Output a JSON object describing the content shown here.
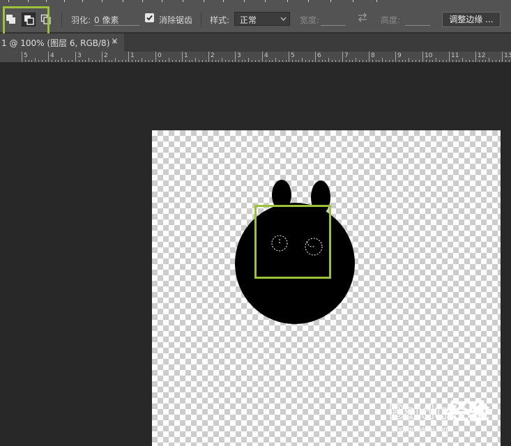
{
  "options_bar": {
    "selection_modes": [
      "new-selection",
      "add-to-selection",
      "subtract-from-selection"
    ],
    "feather_label": "羽化:",
    "feather_value": "0 像素",
    "antialias_label": "消除锯齿",
    "antialias_checked": true,
    "style_label": "样式:",
    "style_value": "正常",
    "width_label": "宽度:",
    "height_label": "高度:",
    "refine_edge_label": "调整边缘 ..."
  },
  "document_tab": {
    "title": "1 @ 100% (图层 6, RGB/8) *",
    "close_glyph": "×"
  },
  "ruler": {
    "labels": [
      "5",
      "4",
      "3",
      "2",
      "1",
      "0",
      "1",
      "2",
      "3",
      "4",
      "5",
      "6",
      "7",
      "8",
      "9",
      "10",
      "11",
      "12",
      "13"
    ]
  },
  "watermark": {
    "text": "Baidu经验",
    "sub": "jingyan.baidu.com"
  },
  "colors": {
    "highlight": "#9bc23a",
    "panel": "#535353",
    "workspace": "#282828"
  }
}
